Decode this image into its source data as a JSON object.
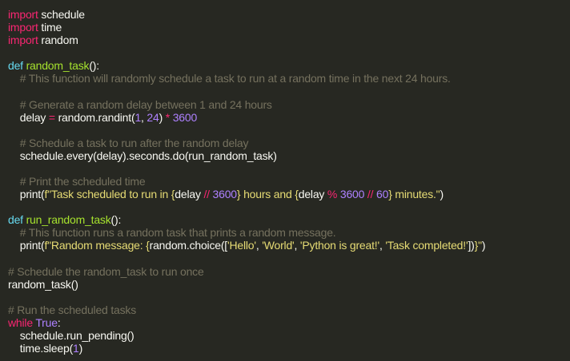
{
  "theme": {
    "background": "#272822",
    "text": "#f8f8f2",
    "keyword": "#f92672",
    "def": "#66d9ef",
    "function": "#a6e22e",
    "comment": "#75715e",
    "number": "#ae81ff",
    "string": "#e6db74"
  },
  "code": [
    [
      [
        "kw",
        "import"
      ],
      [
        "tx",
        " schedule"
      ]
    ],
    [
      [
        "kw",
        "import"
      ],
      [
        "tx",
        " time"
      ]
    ],
    [
      [
        "kw",
        "import"
      ],
      [
        "tx",
        " random"
      ]
    ],
    [],
    [
      [
        "def",
        "def"
      ],
      [
        "tx",
        " "
      ],
      [
        "fn",
        "random_task"
      ],
      [
        "tx",
        "():"
      ]
    ],
    [
      [
        "tx",
        "    "
      ],
      [
        "cm",
        "# This function will randomly schedule a task to run at a random time in the next 24 hours."
      ]
    ],
    [],
    [
      [
        "tx",
        "    "
      ],
      [
        "cm",
        "# Generate a random delay between 1 and 24 hours"
      ]
    ],
    [
      [
        "tx",
        "    delay "
      ],
      [
        "op",
        "="
      ],
      [
        "tx",
        " random.randint("
      ],
      [
        "num",
        "1"
      ],
      [
        "tx",
        ", "
      ],
      [
        "num",
        "24"
      ],
      [
        "tx",
        ") "
      ],
      [
        "op",
        "*"
      ],
      [
        "tx",
        " "
      ],
      [
        "num",
        "3600"
      ]
    ],
    [],
    [
      [
        "tx",
        "    "
      ],
      [
        "cm",
        "# Schedule a task to run after the random delay"
      ]
    ],
    [
      [
        "tx",
        "    schedule.every(delay).seconds.do(run_random_task)"
      ]
    ],
    [],
    [
      [
        "tx",
        "    "
      ],
      [
        "cm",
        "# Print the scheduled time"
      ]
    ],
    [
      [
        "tx",
        "    print("
      ],
      [
        "str",
        "f\"Task scheduled to run in "
      ],
      [
        "str",
        "{"
      ],
      [
        "tx",
        "delay "
      ],
      [
        "op",
        "//"
      ],
      [
        "tx",
        " "
      ],
      [
        "num",
        "3600"
      ],
      [
        "str",
        "}"
      ],
      [
        "str",
        " hours and "
      ],
      [
        "str",
        "{"
      ],
      [
        "tx",
        "delay "
      ],
      [
        "op",
        "%"
      ],
      [
        "tx",
        " "
      ],
      [
        "num",
        "3600"
      ],
      [
        "tx",
        " "
      ],
      [
        "op",
        "//"
      ],
      [
        "tx",
        " "
      ],
      [
        "num",
        "60"
      ],
      [
        "str",
        "}"
      ],
      [
        "str",
        " minutes.\""
      ],
      [
        "tx",
        ")"
      ]
    ],
    [],
    [
      [
        "def",
        "def"
      ],
      [
        "tx",
        " "
      ],
      [
        "fn",
        "run_random_task"
      ],
      [
        "tx",
        "():"
      ]
    ],
    [
      [
        "tx",
        "    "
      ],
      [
        "cm",
        "# This function runs a random task that prints a random message."
      ]
    ],
    [
      [
        "tx",
        "    print("
      ],
      [
        "str",
        "f\"Random message: "
      ],
      [
        "str",
        "{"
      ],
      [
        "tx",
        "random.choice(["
      ],
      [
        "str",
        "'Hello'"
      ],
      [
        "tx",
        ", "
      ],
      [
        "str",
        "'World'"
      ],
      [
        "tx",
        ", "
      ],
      [
        "str",
        "'Python is great!'"
      ],
      [
        "tx",
        ", "
      ],
      [
        "str",
        "'Task completed!'"
      ],
      [
        "tx",
        "])"
      ],
      [
        "str",
        "}\""
      ],
      [
        "tx",
        ")"
      ]
    ],
    [],
    [
      [
        "cm",
        "# Schedule the random_task to run once"
      ]
    ],
    [
      [
        "tx",
        "random_task()"
      ]
    ],
    [],
    [
      [
        "cm",
        "# Run the scheduled tasks"
      ]
    ],
    [
      [
        "kw",
        "while"
      ],
      [
        "tx",
        " "
      ],
      [
        "const",
        "True"
      ],
      [
        "tx",
        ":"
      ]
    ],
    [
      [
        "tx",
        "    schedule.run_pending()"
      ]
    ],
    [
      [
        "tx",
        "    time.sleep("
      ],
      [
        "num",
        "1"
      ],
      [
        "tx",
        ")"
      ]
    ]
  ]
}
